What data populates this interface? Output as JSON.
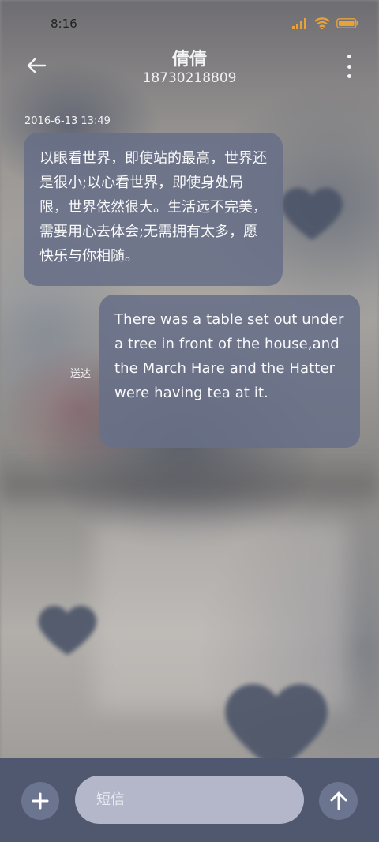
{
  "status_bar": {
    "time": "8:16",
    "icons": [
      "signal-icon",
      "wifi-icon",
      "battery-icon"
    ],
    "accent": "#e8a23a"
  },
  "header": {
    "contact_name": "倩倩",
    "contact_number": "18730218809",
    "back_icon": "arrow-left-icon",
    "more_icon": "more-vertical-icon"
  },
  "conversation": {
    "timestamp": "2016-6-13 13:49",
    "messages": [
      {
        "direction": "incoming",
        "text": "以眼看世界，即使站的最高，世界还是很小;以心看世界，即使身处局限，世界依然很大。生活远不完美，需要用心去体会;无需拥有太多，愿快乐与你相随。"
      },
      {
        "direction": "outgoing",
        "status": "送达",
        "text": "There was a table set out under a tree in front of the house,and the March Hare and the Hatter were having tea at it."
      }
    ]
  },
  "composer": {
    "placeholder": "短信",
    "add_icon": "plus-icon",
    "send_icon": "arrow-up-icon"
  },
  "colors": {
    "bubble": "#687088",
    "composer_bar": "#505870",
    "input_field": "#b3b7c9",
    "button": "#6c7590"
  }
}
